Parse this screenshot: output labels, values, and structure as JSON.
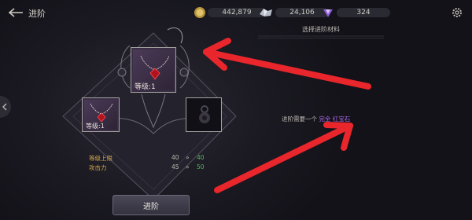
{
  "header": {
    "title": "进阶"
  },
  "resources": [
    {
      "icon": "gold-coin-icon",
      "value": "442,879"
    },
    {
      "icon": "silver-crystal-icon",
      "value": "24,106"
    },
    {
      "icon": "purple-gem-icon",
      "value": "324"
    }
  ],
  "panel": {
    "heading": "选择进阶材料",
    "need_prefix": "进阶需要一个",
    "need_item": "完全 红宝石"
  },
  "slots": {
    "main_level": "等级:1",
    "material_level": "等级:1"
  },
  "stats": [
    {
      "label": "等级上限",
      "current": "40",
      "arrow": "»",
      "next": "40"
    },
    {
      "label": "攻击力",
      "current": "45",
      "arrow": "»",
      "next": "50"
    }
  ],
  "advance_button": "进阶",
  "colors": {
    "annotation_red": "#e8262b",
    "highlight_purple": "#b46bf2",
    "stat_label_gold": "#d1a54a",
    "stat_increase_green": "#58b75c"
  }
}
